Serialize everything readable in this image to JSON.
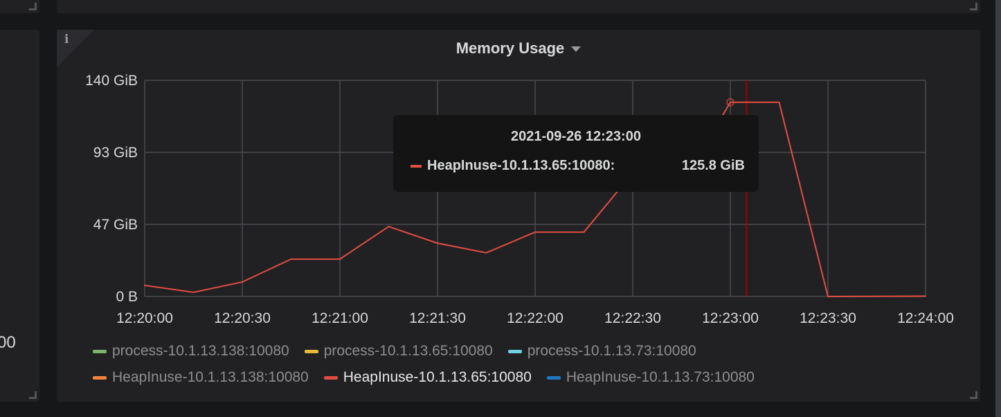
{
  "left_panel": {
    "value_fragment": "00"
  },
  "panel": {
    "title": "Memory Usage",
    "info_icon": "info-icon",
    "tooltip": {
      "time": "2021-09-26 12:23:00",
      "series": "HeapInuse-10.1.13.65:10080:",
      "value": "125.8 GiB",
      "color": "#e24d42"
    },
    "legend": [
      {
        "label": "process-10.1.13.138:10080",
        "color": "#7eb26d"
      },
      {
        "label": "process-10.1.13.65:10080",
        "color": "#eab839"
      },
      {
        "label": "process-10.1.13.73:10080",
        "color": "#6ed0e0"
      },
      {
        "label": "HeapInuse-10.1.13.138:10080",
        "color": "#ef843c"
      },
      {
        "label": "HeapInuse-10.1.13.65:10080",
        "color": "#e24d42",
        "active": true
      },
      {
        "label": "HeapInuse-10.1.13.73:10080",
        "color": "#1f78c1"
      }
    ]
  },
  "chart_data": {
    "type": "line",
    "title": "Memory Usage",
    "xlabel": "",
    "ylabel": "",
    "x_ticks": [
      "12:20:00",
      "12:20:30",
      "12:21:00",
      "12:21:30",
      "12:22:00",
      "12:22:30",
      "12:23:00",
      "12:23:30",
      "12:24:00"
    ],
    "y_ticks": [
      "0 B",
      "47 GiB",
      "93 GiB",
      "140 GiB"
    ],
    "ylim": [
      0,
      140
    ],
    "xlim_seconds": [
      0,
      240
    ],
    "grid": true,
    "legend_position": "bottom",
    "hover_time_seconds": 185,
    "series": [
      {
        "name": "HeapInuse-10.1.13.65:10080",
        "color": "#e24d42",
        "x_seconds": [
          0,
          15,
          30,
          45,
          60,
          75,
          90,
          105,
          120,
          135,
          150,
          165,
          180,
          195,
          210,
          225,
          240
        ],
        "values": [
          7.2,
          2.7,
          9.4,
          24.2,
          24.2,
          45.3,
          34.5,
          28.3,
          41.7,
          41.7,
          80,
          72,
          125.8,
          125.8,
          0,
          0.1,
          0.2
        ]
      }
    ]
  }
}
